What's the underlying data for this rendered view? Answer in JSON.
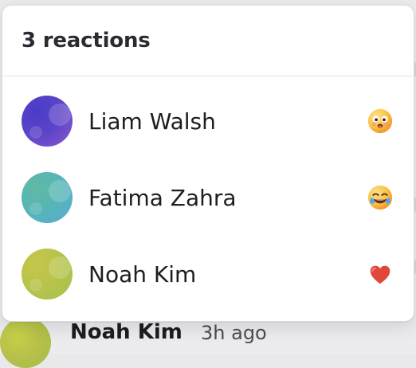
{
  "popover": {
    "title": "3 reactions",
    "items": [
      {
        "name": "Liam Walsh",
        "reaction": "flushed-face",
        "avatar_style": "liam"
      },
      {
        "name": "Fatima Zahra",
        "reaction": "tears-of-joy",
        "avatar_style": "fatima"
      },
      {
        "name": "Noah Kim",
        "reaction": "red-heart",
        "avatar_style": "noah"
      }
    ]
  },
  "background": {
    "comment": {
      "author": "Noah Kim",
      "time": "3h ago"
    }
  },
  "colors": {
    "heart": "#e0483a",
    "emoji_yellow": "#f6c344",
    "emoji_orange": "#f39a2f"
  }
}
